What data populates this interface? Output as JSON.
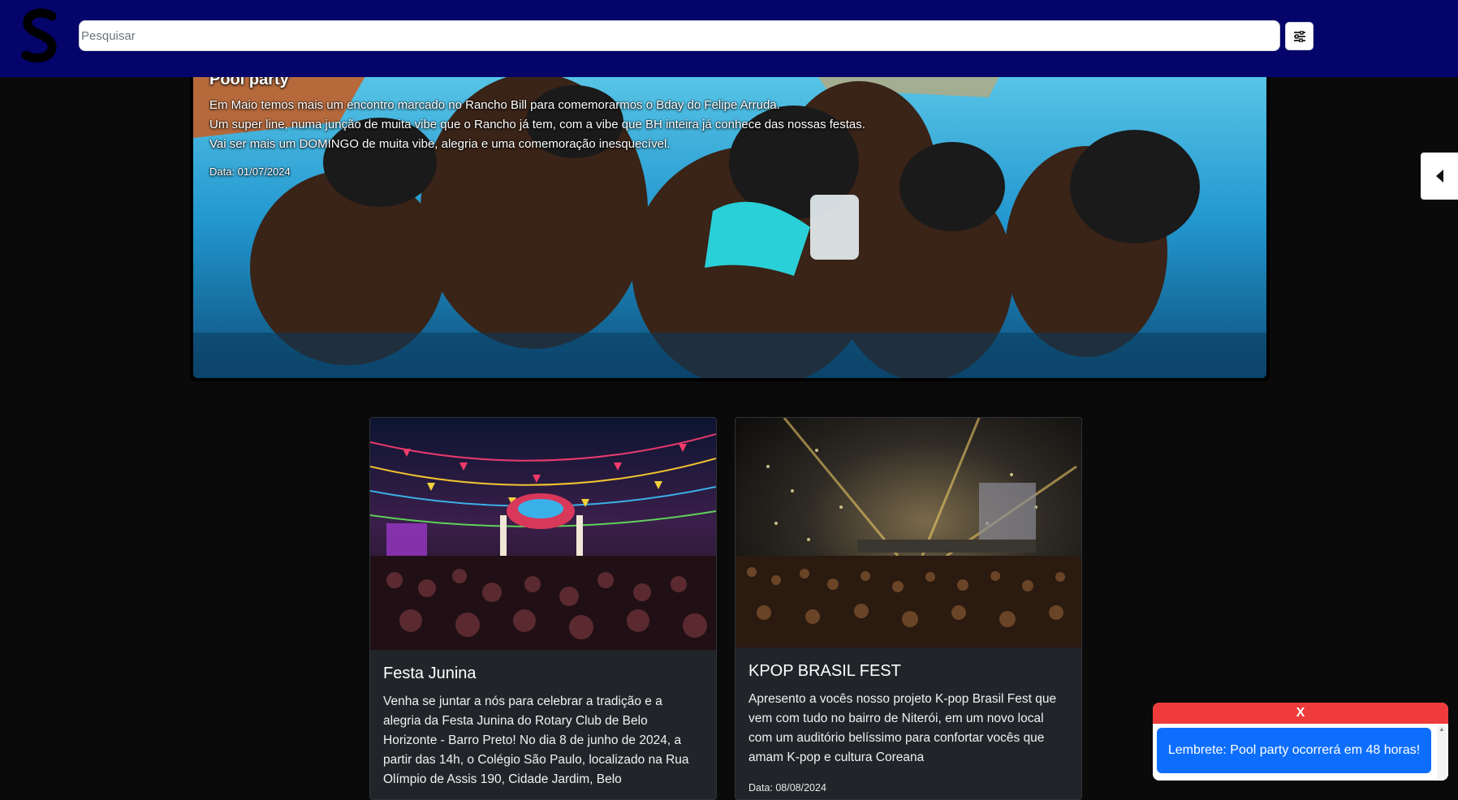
{
  "header": {
    "search_placeholder": "Pesquisar",
    "filter_icon": "sliders-icon",
    "logo_icon": "s-logo-icon"
  },
  "hero": {
    "title": "Pool party",
    "lines": [
      "Em Maio temos mais um encontro marcado no Rancho Bill para comemorarmos o Bday do Felipe Arruda.",
      "Um super line, numa junção de muita vibe que o Rancho já tem, com a vibe que BH inteira já conhece das nossas festas.",
      "Vai ser mais um DOMINGO de muita vibe, alegria e uma comemoração inesquecível."
    ],
    "date": "Data: 01/07/2024"
  },
  "sidebar_toggle_icon": "caret-left-icon",
  "cards": [
    {
      "title": "Festa Junina",
      "text": "Venha se juntar a nós para celebrar a tradição e a alegria da Festa Junina do Rotary Club de Belo Horizonte - Barro Preto! No dia 8 de junho de 2024, a partir das 14h, o Colégio São Paulo, localizado na Rua Olímpio de Assis 190, Cidade Jardim, Belo",
      "date": ""
    },
    {
      "title": "KPOP BRASIL FEST",
      "text": "Apresento a vocês nosso projeto K-pop Brasil Fest que vem com tudo no bairro de Niterói, em um novo local com um auditório belíssimo para confortar vocês que amam K-pop e cultura Coreana",
      "date": "Data: 08/08/2024"
    }
  ],
  "toast": {
    "close_label": "X",
    "message": "Lembrete: Pool party ocorrerá em 48 horas!"
  },
  "colors": {
    "topbar": "#04046b",
    "background": "#0a0a0a",
    "card": "#212529",
    "toast_header": "#ef3b3b",
    "toast_message": "#0d6efd"
  }
}
